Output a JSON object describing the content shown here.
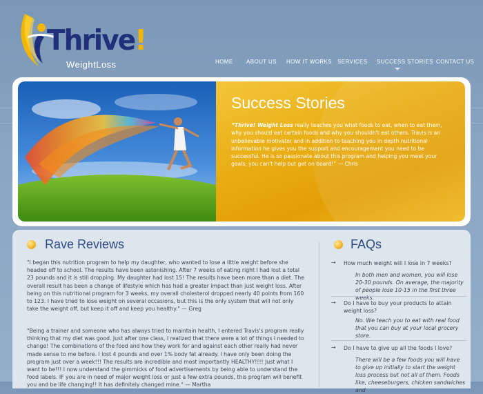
{
  "brand": {
    "name": "Thrive",
    "exclaim": "!",
    "sub": "WeightLoss"
  },
  "nav": [
    {
      "label": "HOME"
    },
    {
      "label": "ABOUT US"
    },
    {
      "label": "HOW IT WORKS"
    },
    {
      "label": "SERVICES"
    },
    {
      "label": "SUCCESS STORIES"
    },
    {
      "label": "CONTACT US"
    }
  ],
  "hero": {
    "title": "Success Stories",
    "quote_brand": "“Thrive! Weight Loss",
    "quote_body": " really teaches you what foods to eat, when to eat them, why you should eat certain foods and why you shouldn't eat others. Travis is an unbelievable motivator and in addition to teaching you in depth nutritional information he gives you the support and encouragement you need to be successful. He is so passionate about this program and helping you meet your goals; you can't help but get on board!” — Chris"
  },
  "reviews": {
    "title": "Rave Reviews",
    "items": [
      "\"I began this nutrition program to help my daughter, who wanted to lose a little weight before she headed off to school. The results have been astonishing. After 7 weeks of eating right I had lost a total 23 pounds and it is still dropping. My daughter had lost 15! The results have been more than a diet. The overall result has been a change of lifestyle which has had a greater impact than just weight loss. After being on this nutritional program for 3 weeks, my overall cholesterol dropped nearly 40 points from 160 to 123. I have tried to lose weight on several occasions, but this is the only system that will not only take the weight off, but keep it off and keep you healthy.\" — Greg",
      "\"Being a trainer and someone who has always tried to maintain health, I entered Travis's program really thinking that my diet was good. Just after one class, I realized that there were a lot of things I needed to change! The combinations of the food and how they work for and against each other really had never made sense to me before. I lost 4 pounds and over 1% body fat already. I have only been doing the program just over a week!!! The results are incredible and most importantly HEALTHY!!!! Just what I want to be!!! I now understand the gimmicks of food advertisements by being able to understand the food labels. IF you are in need of major weight loss or just a few extra pounds, this program will benefit you and be life changing!! It has definitely changed mine.\" — Martha"
    ]
  },
  "faqs": {
    "title": "FAQs",
    "items": [
      {
        "q": "How much weight will I lose in 7 weeks?",
        "a": "In both men and women, you will lose 20-30 pounds. On average, the majority of people lose 10-15 in the first three weeks."
      },
      {
        "q": "Do I have to buy your products to attain weight loss?",
        "a": "No. We teach you to eat with real food that you can buy at your local grocery store."
      },
      {
        "q": "Do I have to give up all the foods I love?",
        "a": "There will be a few foods you will have to give up initially to start the weight loss process but not all of them. Foods like, cheeseburgers, chicken sandwiches and"
      }
    ]
  },
  "colors": {
    "accent_gold": "#e8ab10",
    "brand_navy": "#1f2f7a",
    "title_blue": "#2d4b82",
    "background": "#8aa5c2"
  },
  "icons": {
    "faq_arrow": "arrow-right-icon",
    "section_bullet": "orb-bullet-icon",
    "nav_indicator": "triangle-down-icon"
  }
}
